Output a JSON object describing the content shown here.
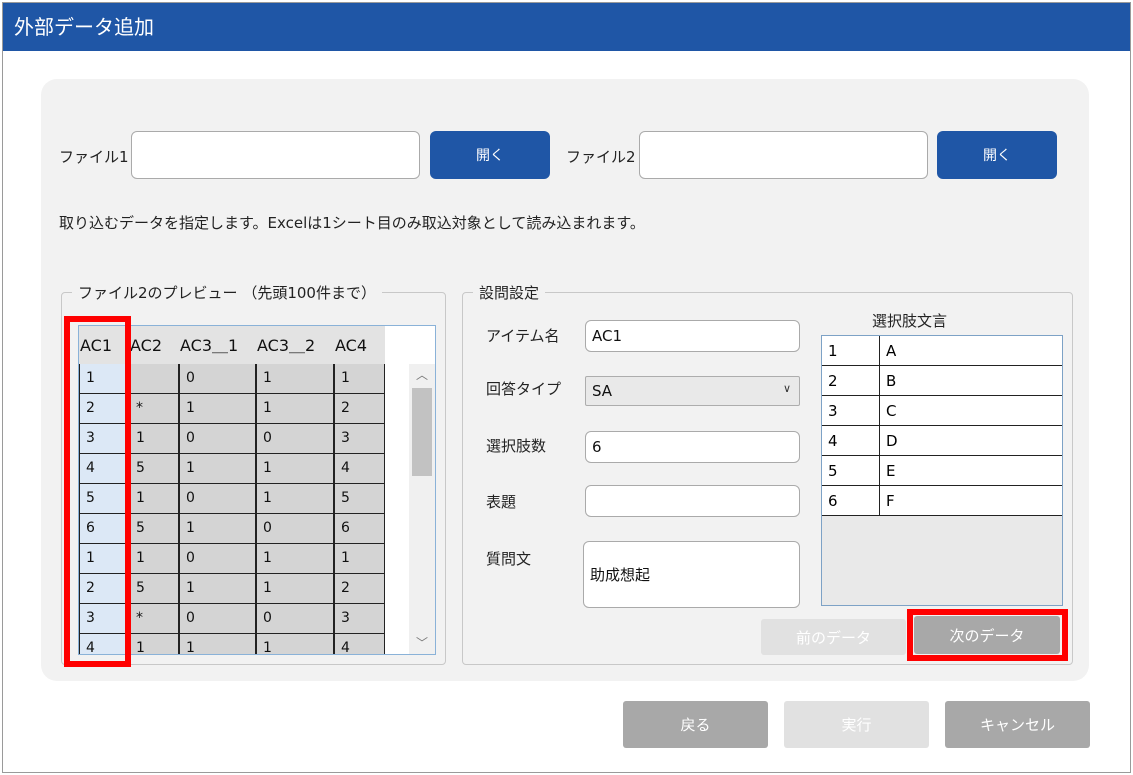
{
  "window": {
    "title": "外部データ追加"
  },
  "files": {
    "file1": {
      "label": "ファイル1",
      "value": "",
      "button": "開く"
    },
    "file2": {
      "label": "ファイル2",
      "value": "",
      "button": "開く"
    }
  },
  "instruction": "取り込むデータを指定します。Excelは1シート目のみ取込対象として読み込まれます。",
  "preview": {
    "title": "ファイル2のプレビュー （先頭100件まで）",
    "columns": [
      "AC1",
      "AC2",
      "AC3＿1",
      "AC3＿2",
      "AC4"
    ],
    "rows": [
      [
        "1",
        "",
        "0",
        "1",
        "1"
      ],
      [
        "2",
        "*",
        "1",
        "1",
        "2"
      ],
      [
        "3",
        "1",
        "0",
        "0",
        "3"
      ],
      [
        "4",
        "5",
        "1",
        "1",
        "4"
      ],
      [
        "5",
        "1",
        "0",
        "1",
        "5"
      ],
      [
        "6",
        "5",
        "1",
        "0",
        "6"
      ],
      [
        "1",
        "1",
        "0",
        "1",
        "1"
      ],
      [
        "2",
        "5",
        "1",
        "1",
        "2"
      ],
      [
        "3",
        "*",
        "0",
        "0",
        "3"
      ],
      [
        "4",
        "1",
        "1",
        "1",
        "4"
      ]
    ]
  },
  "question": {
    "title": "設問設定",
    "item_name_label": "アイテム名",
    "item_name_value": "AC1",
    "answer_type_label": "回答タイプ",
    "answer_type_value": "SA",
    "choice_count_label": "選択肢数",
    "choice_count_value": "6",
    "heading_label": "表題",
    "heading_value": "",
    "question_text_label": "質問文",
    "question_text_value": "助成想起",
    "choices_title": "選択肢文言",
    "choices": [
      {
        "num": "1",
        "text": "A"
      },
      {
        "num": "2",
        "text": "B"
      },
      {
        "num": "3",
        "text": "C"
      },
      {
        "num": "4",
        "text": "D"
      },
      {
        "num": "5",
        "text": "E"
      },
      {
        "num": "6",
        "text": "F"
      }
    ],
    "prev_button": "前のデータ",
    "next_button": "次のデータ"
  },
  "footer": {
    "back": "戻る",
    "run": "実行",
    "cancel": "キャンセル"
  },
  "colors": {
    "accent": "#1f56a6",
    "highlight": "#ff0000"
  }
}
